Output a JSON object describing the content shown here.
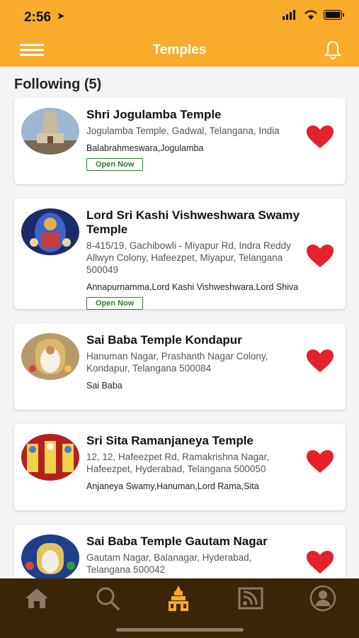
{
  "status": {
    "time": "2:56"
  },
  "header": {
    "title": "Temples"
  },
  "section": {
    "title": "Following (5)"
  },
  "temples": [
    {
      "name": "Shri Jogulamba Temple",
      "address": "Jogulamba Temple, Gadwal, Telangana, India",
      "deities": "Balabrahmeswara,Jogulamba",
      "status": "Open Now"
    },
    {
      "name": "Lord Sri Kashi Vishweshwara Swamy Temple",
      "address": "8-415/19, Gachibowli - Miyapur Rd, Indra Reddy Allwyn Colony, Hafeezpet, Miyapur, Telangana 500049",
      "deities": "Annapurnamma,Lord Kashi Vishweshwara,Lord Shiva",
      "status": "Open Now"
    },
    {
      "name": "Sai Baba Temple Kondapur",
      "address": "Hanuman Nagar, Prashanth Nagar Colony, Kondapur, Telangana 500084",
      "deities": "Sai Baba",
      "status": ""
    },
    {
      "name": "Sri Sita Ramanjaneya Temple",
      "address": "12, 12, Hafeezpet Rd, Ramakrishna Nagar, Hafeezpet, Hyderabad, Telangana 500050",
      "deities": "Anjaneya Swamy,Hanuman,Lord Rama,Sita",
      "status": ""
    },
    {
      "name": "Sai Baba Temple Gautam Nagar",
      "address": "Gautam Nagar, Balanagar, Hyderabad, Telangana 500042",
      "deities": "",
      "status": ""
    }
  ],
  "tabs": [
    {
      "icon": "home-icon",
      "active": false
    },
    {
      "icon": "search-icon",
      "active": false
    },
    {
      "icon": "temple-icon",
      "active": true
    },
    {
      "icon": "feed-icon",
      "active": false
    },
    {
      "icon": "profile-icon",
      "active": false
    }
  ],
  "colors": {
    "header": "#f9ab2b",
    "heart": "#e4212d",
    "open": "#2e7d32",
    "tabbar": "#3b2506",
    "active_tab": "#f9ab2b",
    "inactive_tab": "#8a7a66"
  }
}
